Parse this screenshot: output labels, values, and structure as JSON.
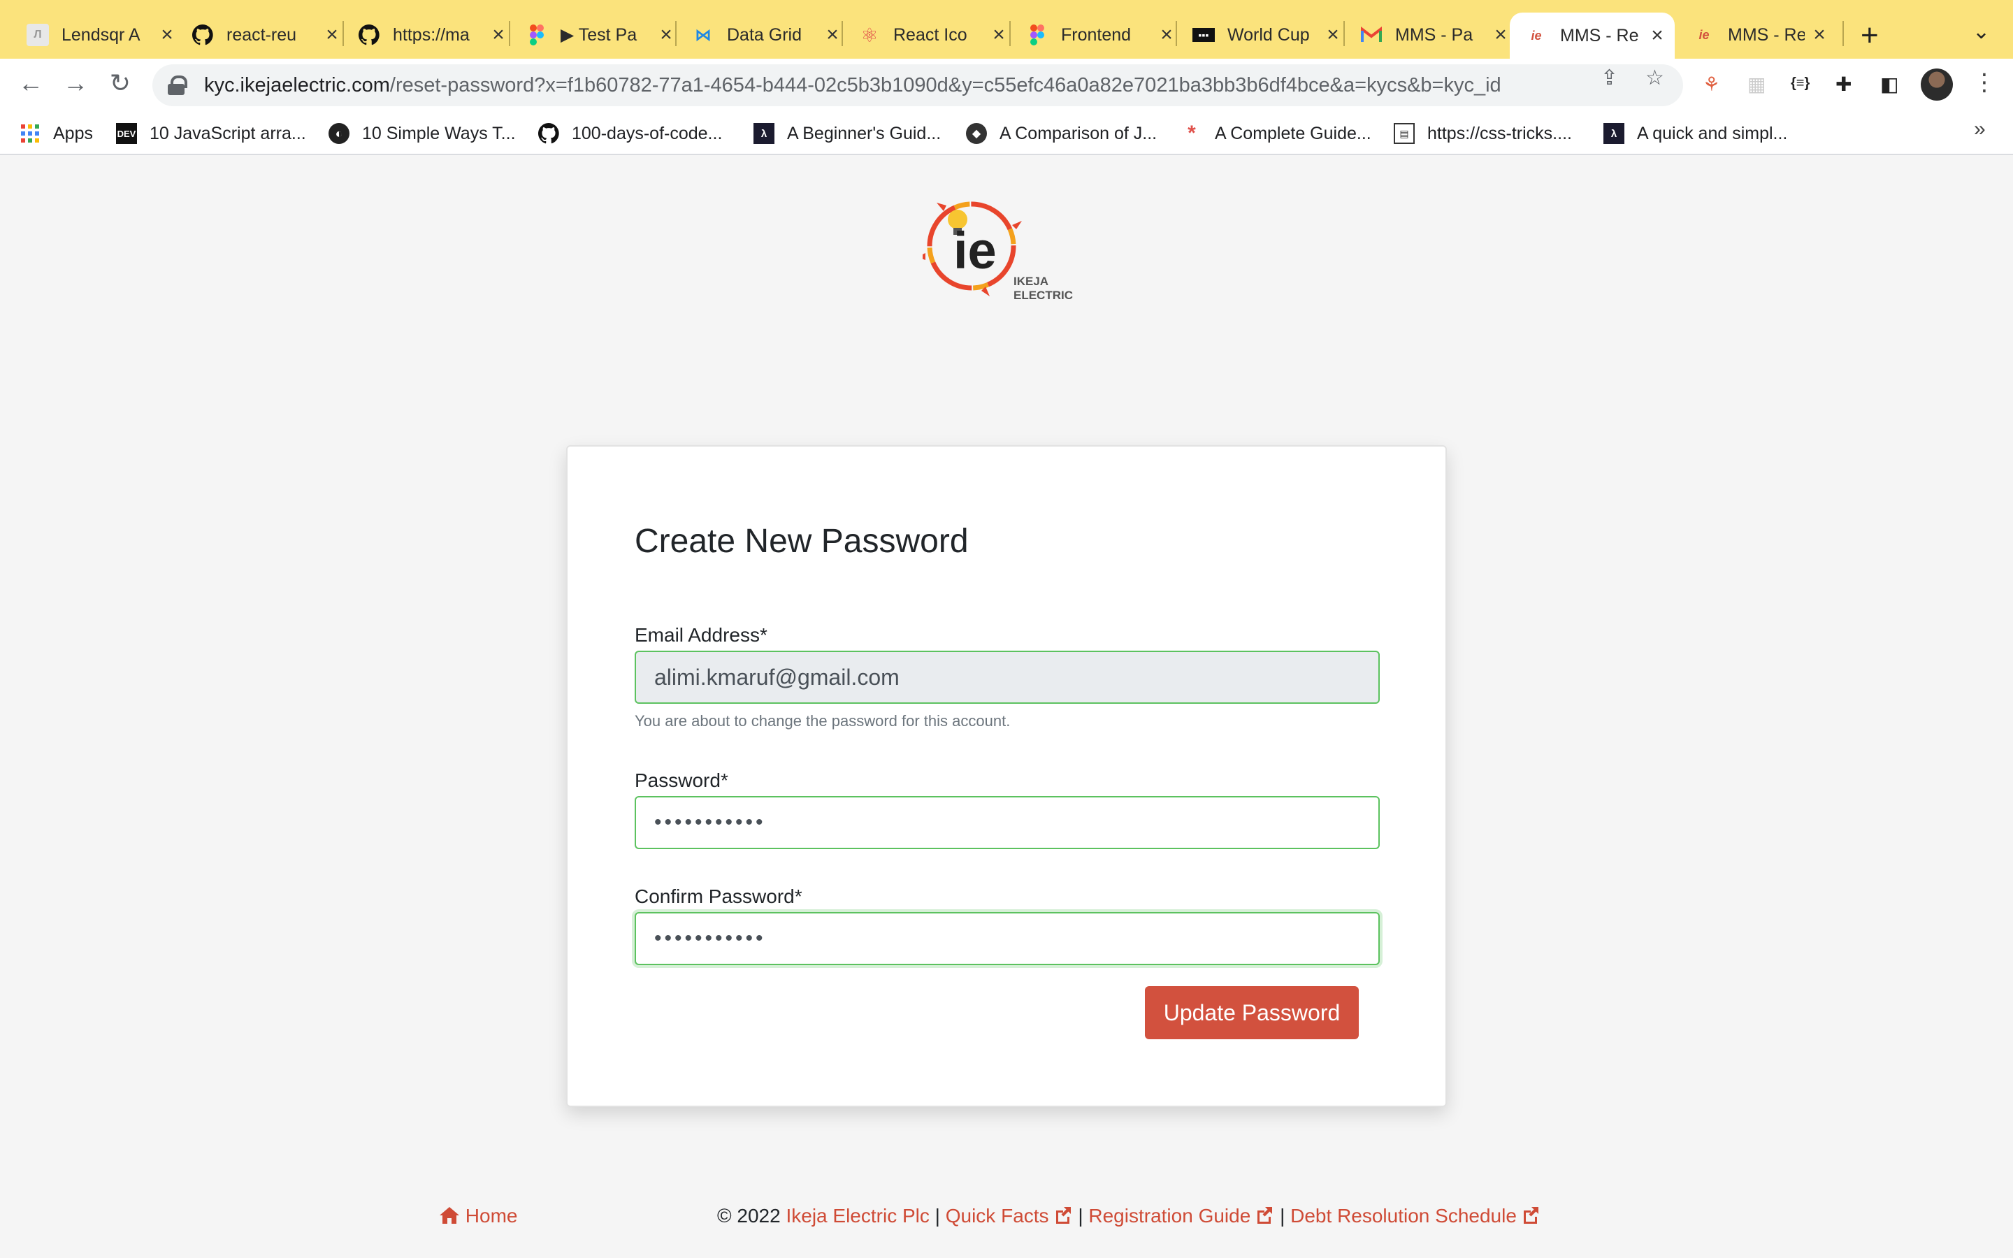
{
  "browser": {
    "tabs": [
      {
        "icon": "lendsqr-icon",
        "title": "Lendsqr A"
      },
      {
        "icon": "github-icon",
        "title": "react-reu"
      },
      {
        "icon": "github-icon",
        "title": "https://ma"
      },
      {
        "icon": "figma-icon",
        "title": "▶ Test Pa"
      },
      {
        "icon": "mui-icon",
        "title": "Data Grid"
      },
      {
        "icon": "react-icon",
        "title": "React Ico"
      },
      {
        "icon": "figma-icon",
        "title": "Frontend"
      },
      {
        "icon": "worldcup-icon",
        "title": "World Cup"
      },
      {
        "icon": "gmail-icon",
        "title": "MMS - Pa"
      },
      {
        "icon": "ikeja-icon",
        "title": "MMS - Re"
      },
      {
        "icon": "ikeja-icon",
        "title": "MMS - Re"
      }
    ],
    "active_tab": 9,
    "url_host": "kyc.ikejaelectric.com",
    "url_path": "/reset-password?x=f1b60782-77a1-4654-b444-02c5b3b1090d&y=c55efc46a0a82e7021ba3bb3b6df4bce&a=kycs&b=kyc_id",
    "bookmarks": [
      {
        "icon": "apps-grid-icon",
        "label": "Apps"
      },
      {
        "icon": "dev-icon",
        "label": "10 JavaScript arra..."
      },
      {
        "icon": "globe-icon",
        "label": "10 Simple Ways T..."
      },
      {
        "icon": "github-icon",
        "label": "100-days-of-code..."
      },
      {
        "icon": "lambda-icon",
        "label": "A Beginner's Guid..."
      },
      {
        "icon": "diamond-icon",
        "label": "A Comparison of J..."
      },
      {
        "icon": "asterisk-icon",
        "label": "A Complete Guide..."
      },
      {
        "icon": "card-icon",
        "label": "https://css-tricks...."
      },
      {
        "icon": "lambda-icon",
        "label": "A quick and simpl..."
      }
    ]
  },
  "logo": {
    "mark": "ie",
    "line1": "IKEJA",
    "line2": "ELECTRIC"
  },
  "form": {
    "title": "Create New Password",
    "email_label": "Email Address*",
    "email_value": "alimi.kmaruf@gmail.com",
    "email_help": "You are about to change the password for this account.",
    "password_label": "Password*",
    "password_value": "•••••••••••",
    "confirm_label": "Confirm Password*",
    "confirm_value": "•••••••••••",
    "submit_label": "Update Password"
  },
  "footer": {
    "home": "Home",
    "copyright": "© 2022",
    "company": "Ikeja Electric Plc",
    "sep": "|",
    "quick_facts": "Quick Facts",
    "registration_guide": "Registration Guide",
    "debt_schedule": "Debt Resolution Schedule"
  },
  "colors": {
    "tabstrip": "#fbe37c",
    "accent": "#d2513e",
    "link": "#cf4b36",
    "valid_border": "#5cc25f"
  }
}
